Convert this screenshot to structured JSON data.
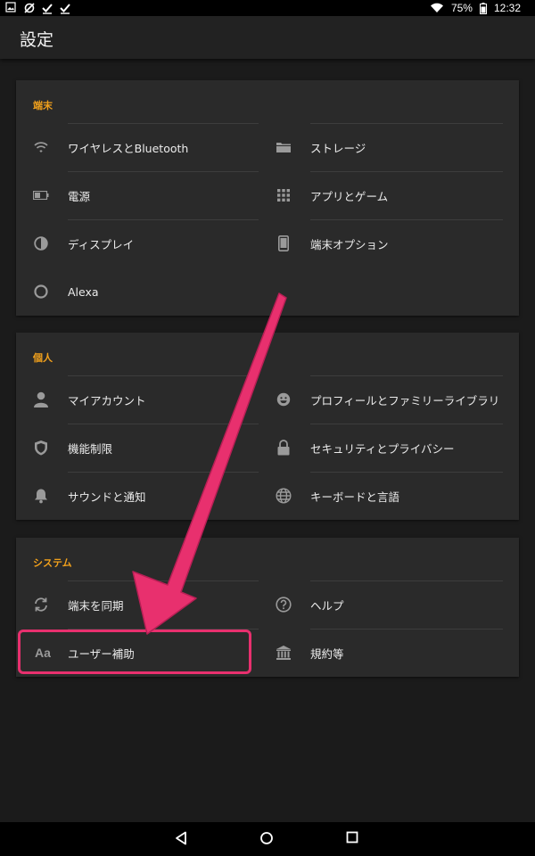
{
  "status_bar": {
    "battery_percent": "75%",
    "time": "12:32"
  },
  "app_bar": {
    "title": "設定"
  },
  "sections": [
    {
      "title": "端末",
      "items": [
        {
          "label": "ワイヤレスとBluetooth",
          "icon": "wifi-icon"
        },
        {
          "label": "ストレージ",
          "icon": "folder-icon"
        },
        {
          "label": "電源",
          "icon": "battery-icon"
        },
        {
          "label": "アプリとゲーム",
          "icon": "grid-icon"
        },
        {
          "label": "ディスプレイ",
          "icon": "contrast-icon"
        },
        {
          "label": "端末オプション",
          "icon": "tablet-icon"
        },
        {
          "label": "Alexa",
          "icon": "alexa-ring-icon"
        }
      ]
    },
    {
      "title": "個人",
      "items": [
        {
          "label": "マイアカウント",
          "icon": "person-icon"
        },
        {
          "label": "プロフィールとファミリーライブラリ",
          "icon": "smile-face-icon"
        },
        {
          "label": "機能制限",
          "icon": "shield-icon"
        },
        {
          "label": "セキュリティとプライバシー",
          "icon": "lock-icon"
        },
        {
          "label": "サウンドと通知",
          "icon": "bell-icon"
        },
        {
          "label": "キーボードと言語",
          "icon": "globe-icon"
        }
      ]
    },
    {
      "title": "システム",
      "items": [
        {
          "label": "端末を同期",
          "icon": "sync-icon"
        },
        {
          "label": "ヘルプ",
          "icon": "help-circle-icon"
        },
        {
          "label": "ユーザー補助",
          "icon": "text-aa-icon",
          "icon_text": "Aa"
        },
        {
          "label": "規約等",
          "icon": "institution-icon"
        }
      ]
    }
  ],
  "colors": {
    "accent": "#f0a01c",
    "highlight": "#e8306e",
    "card_bg": "#2a2a2a",
    "page_bg": "#1b1b1b"
  }
}
